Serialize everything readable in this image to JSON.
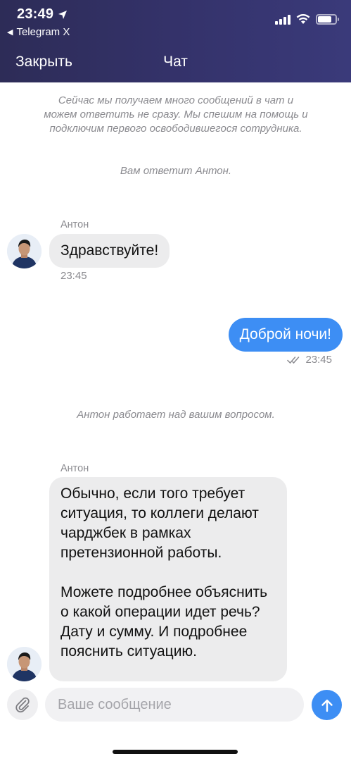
{
  "status_bar": {
    "time": "23:49",
    "back_app": "Telegram X"
  },
  "header": {
    "close_label": "Закрыть",
    "title": "Чат"
  },
  "system_messages": {
    "busy": "Сейчас мы получаем много сообщений в чат и можем ответить не сразу. Мы спешим на помощь и подключим первого освободившегося сотрудника.",
    "assigned": "Вам ответит Антон.",
    "working": "Антон работает над вашим вопросом."
  },
  "messages": [
    {
      "sender": "Антон",
      "text": "Здравствуйте!",
      "time": "23:45"
    },
    {
      "text": "Доброй ночи!",
      "time": "23:45",
      "status": "read"
    },
    {
      "sender": "Антон",
      "text": "Обычно, если того требует ситуация, то коллеги делают чарджбек в рамках претензионной работы.\n\nМожете подробнее объяснить о какой операции идет речь? Дату и сумму. И подробнее пояснить ситуацию."
    }
  ],
  "composer": {
    "placeholder": "Ваше сообщение"
  },
  "colors": {
    "header_bg": "#2f2e5e",
    "outgoing_bubble": "#3d8ef4",
    "incoming_bubble": "#ececed",
    "send_button": "#3d8ef4"
  }
}
